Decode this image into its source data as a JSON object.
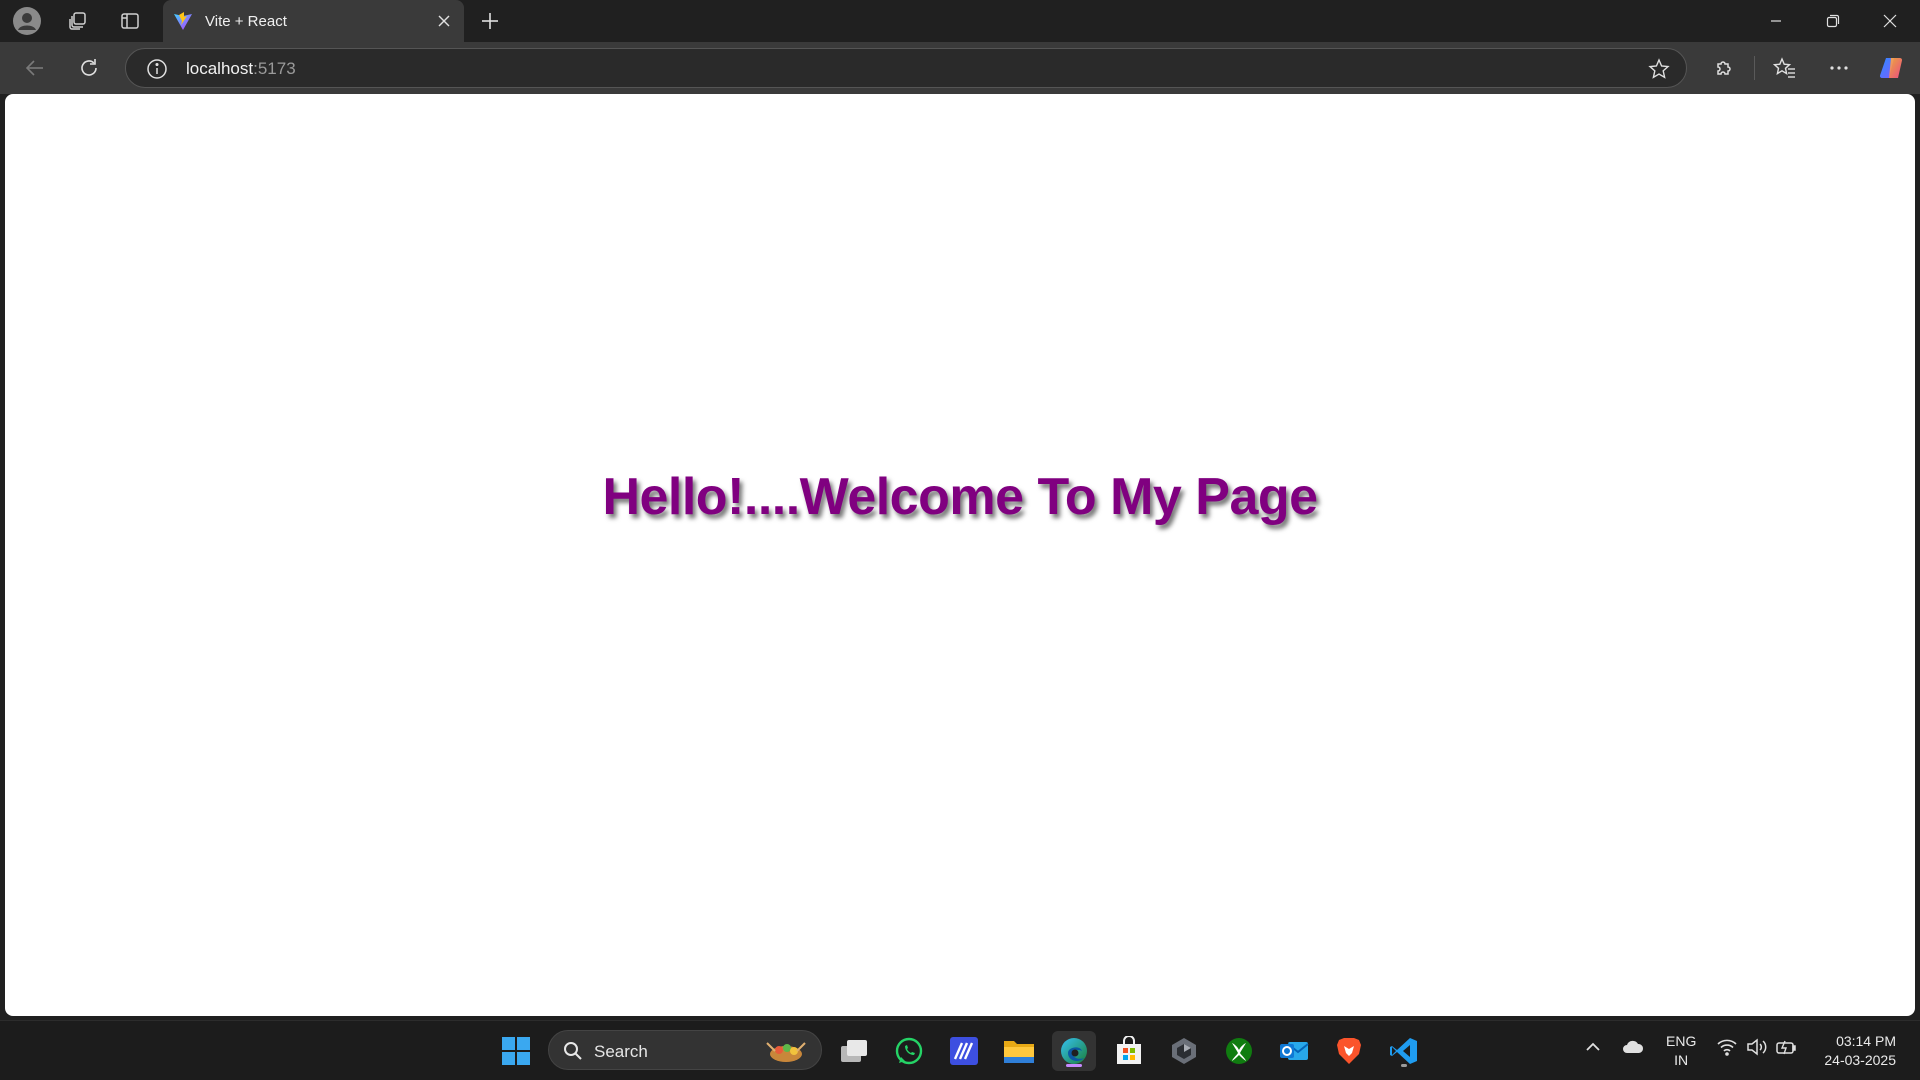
{
  "browser": {
    "tab": {
      "title": "Vite + React",
      "favicon": "vite-logo-icon"
    },
    "address": {
      "host": "localhost",
      "port": ":5173"
    },
    "icons": [
      "profile-icon",
      "workspaces-icon",
      "vertical-tabs-icon",
      "close-icon",
      "plus-icon",
      "minimize-icon",
      "restore-icon",
      "back-icon",
      "refresh-icon",
      "info-icon",
      "star-icon",
      "extensions-icon",
      "favorites-icon",
      "more-icon",
      "copilot-icon"
    ]
  },
  "page": {
    "heading": "Hello!....Welcome To My Page",
    "heading_color": "#800080"
  },
  "taskbar": {
    "search_label": "Search",
    "apps": [
      "windows-start-icon",
      "task-view-icon",
      "whatsapp-icon",
      "app-icon",
      "file-explorer-icon",
      "edge-icon",
      "store-icon",
      "app-icon",
      "xbox-icon",
      "outlook-icon",
      "brave-icon",
      "vscode-icon"
    ],
    "language": {
      "line1": "ENG",
      "line2": "IN"
    },
    "time": "03:14 PM",
    "date": "24-03-2025"
  }
}
